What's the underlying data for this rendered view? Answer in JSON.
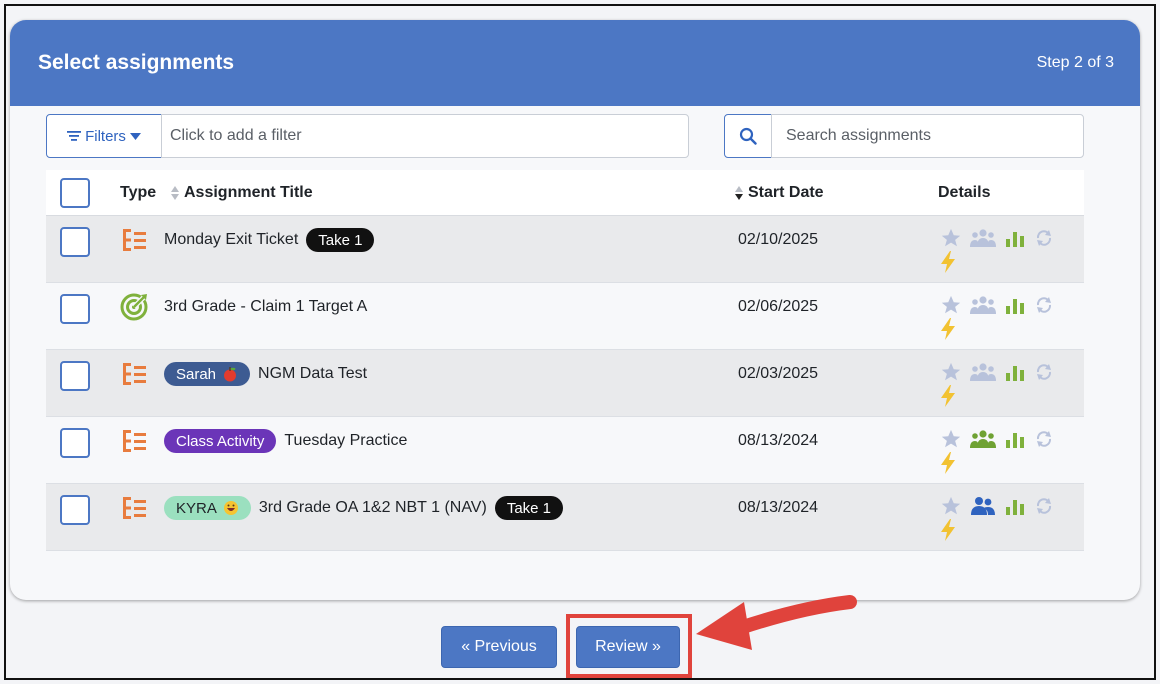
{
  "header": {
    "title": "Select assignments",
    "step": "Step 2 of 3"
  },
  "filters": {
    "button_label": "Filters",
    "placeholder": "Click to add a filter"
  },
  "search": {
    "placeholder": "Search assignments"
  },
  "table": {
    "columns": {
      "type": "Type",
      "title": "Assignment Title",
      "start_date": "Start Date",
      "details": "Details"
    },
    "rows": [
      {
        "type_icon": "list-icon",
        "pre_badge": "",
        "title": "Monday Exit Ticket",
        "post_badge": "Take 1",
        "date": "02/10/2025",
        "people_color": "#b8c2db"
      },
      {
        "type_icon": "target-icon",
        "pre_badge": "",
        "title": "3rd Grade - Claim 1 Target A",
        "post_badge": "",
        "date": "02/06/2025",
        "people_color": "#b8c2db"
      },
      {
        "type_icon": "list-icon",
        "pre_badge": "Sarah",
        "title": "NGM Data Test",
        "post_badge": "",
        "date": "02/03/2025",
        "people_color": "#b8c2db"
      },
      {
        "type_icon": "list-icon",
        "pre_badge": "Class Activity",
        "title": "Tuesday Practice",
        "post_badge": "",
        "date": "08/13/2024",
        "people_color": "#6fa233"
      },
      {
        "type_icon": "list-icon",
        "pre_badge": "KYRA",
        "title": "3rd Grade OA 1&2 NBT 1 (NAV)",
        "post_badge": "Take 1",
        "date": "08/13/2024",
        "people_color": "#2f63bf"
      }
    ]
  },
  "footer": {
    "previous_label": "« Previous",
    "review_label": "Review »"
  },
  "colors": {
    "accent": "#4c77c4",
    "highlight": "#e0433c",
    "list_icon": "#e87c3e",
    "target_icon": "#7fb13c",
    "bars": "#7fb13c",
    "bolt": "#f2c231"
  }
}
